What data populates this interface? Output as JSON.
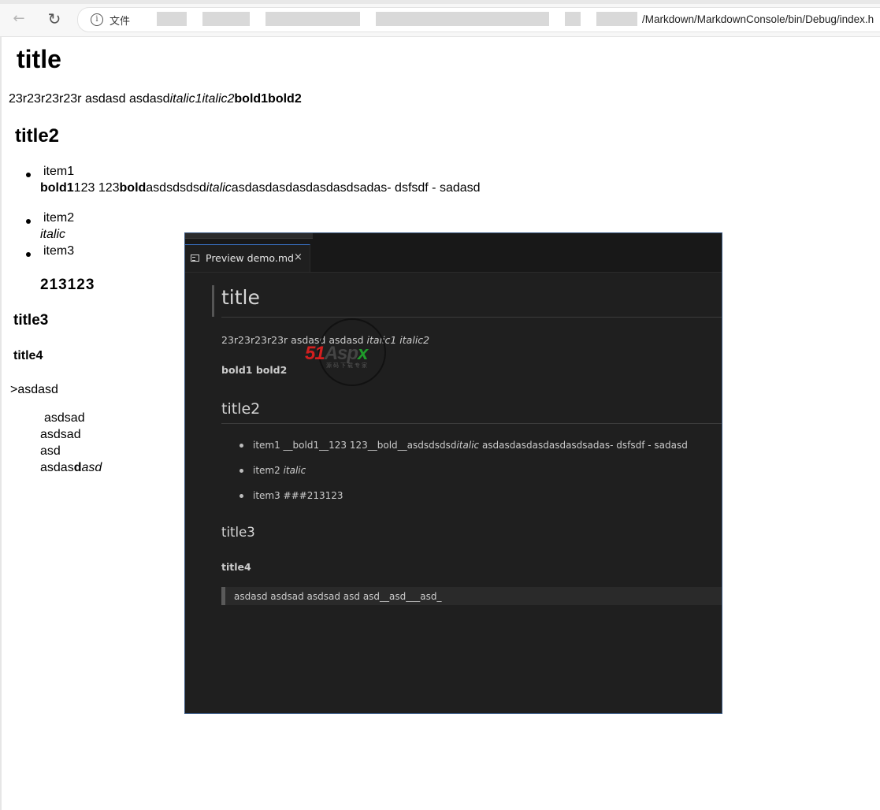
{
  "browser": {
    "nav_back_icon": "arrow-left-icon",
    "reload_icon": "reload-icon",
    "info_icon": "i",
    "address_prefix": "文件",
    "address_tail": "/Markdown/MarkdownConsole/bin/Debug/index.h"
  },
  "page": {
    "h1": "title",
    "p1": {
      "plain": "23r23r23r23r  asdasd  asdasd",
      "italic": "italic1italic2",
      "bold": "bold1bold2"
    },
    "h2": "title2",
    "list": [
      {
        "label": "item1",
        "line2": {
          "b1": "bold1",
          "t1": "123   123",
          "b2": "bold",
          "t2": "asdsdsdsd",
          "i1": "italic",
          "t3": "asdasdasdasdasdasdsadas- dsfsdf - sadasd"
        }
      },
      {
        "label": "item2",
        "line2_italic": "italic"
      },
      {
        "label": "item3"
      }
    ],
    "item3_heading": "213123",
    "h3": "title3",
    "h4": "title4",
    "blockquote": ">asdasd",
    "pre_lines": [
      "asdsad",
      "asdsad",
      "asd"
    ],
    "last_line": {
      "plain": "asdas",
      "bold": "d",
      "italic": "asd"
    }
  },
  "vscode": {
    "tab_label": "Preview demo.md",
    "tab_close": "×",
    "preview": {
      "h1": "title",
      "p_plain": "23r23r23r23r asdasd asdasd ",
      "p_italic": "italic1 italic2",
      "bold_line": "bold1 bold2",
      "h2": "title2",
      "list": [
        {
          "plain": "item1 __bold1__123 123__bold__asdsdsdsd",
          "italic": "italic",
          "tail": " asdasdasdasdasdasdsadas- dsfsdf - sadasd"
        },
        {
          "plain": "item2 ",
          "italic": "italic",
          "tail": ""
        },
        {
          "plain": "item3 ###213123",
          "italic": "",
          "tail": ""
        }
      ],
      "h3": "title3",
      "h4": "title4",
      "blockquote": "asdasd asdsad asdsad asd asd__asd___asd_"
    }
  },
  "watermark": {
    "logo_text": "51Aspx",
    "sub": "源码下载专家"
  }
}
